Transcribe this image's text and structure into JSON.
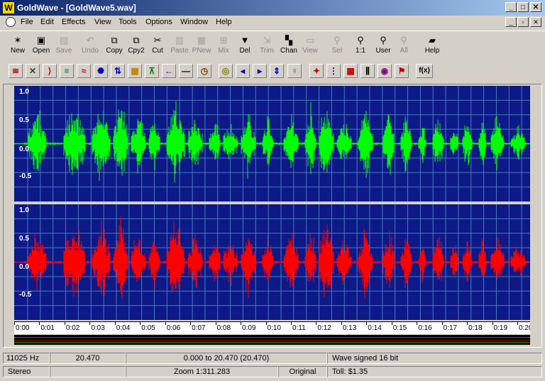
{
  "window": {
    "title": "GoldWave - [GoldWave5.wav]",
    "app_icon": "W"
  },
  "menu": [
    "File",
    "Edit",
    "Effects",
    "View",
    "Tools",
    "Options",
    "Window",
    "Help"
  ],
  "toolbar": [
    {
      "label": "New",
      "icon": "new-icon",
      "glyph": "✶",
      "enabled": true
    },
    {
      "label": "Open",
      "icon": "open-icon",
      "glyph": "▣",
      "enabled": true
    },
    {
      "label": "Save",
      "icon": "save-icon",
      "glyph": "▤",
      "enabled": false
    },
    {
      "label": "Undo",
      "icon": "undo-icon",
      "glyph": "↶",
      "enabled": false
    },
    {
      "label": "Copy",
      "icon": "copy-icon",
      "glyph": "⧉",
      "enabled": true
    },
    {
      "label": "Cpy2",
      "icon": "copy2-icon",
      "glyph": "⧉",
      "enabled": true
    },
    {
      "label": "Cut",
      "icon": "cut-icon",
      "glyph": "✂",
      "enabled": true
    },
    {
      "label": "Paste",
      "icon": "paste-icon",
      "glyph": "▥",
      "enabled": false
    },
    {
      "label": "PNew",
      "icon": "paste-new-icon",
      "glyph": "▦",
      "enabled": false
    },
    {
      "label": "Mix",
      "icon": "mix-icon",
      "glyph": "⊞",
      "enabled": false
    },
    {
      "label": "Del",
      "icon": "delete-icon",
      "glyph": "▼",
      "enabled": true
    },
    {
      "label": "Trim",
      "icon": "trim-icon",
      "glyph": "⇲",
      "enabled": false
    },
    {
      "label": "Chan",
      "icon": "channel-icon",
      "glyph": "▚",
      "enabled": true
    },
    {
      "label": "View",
      "icon": "view-icon",
      "glyph": "▭",
      "enabled": false
    },
    {
      "label": "Sel",
      "icon": "select-icon",
      "glyph": "⚲",
      "enabled": false
    },
    {
      "label": "1:1",
      "icon": "zoom-1-1-icon",
      "glyph": "⚲",
      "enabled": true
    },
    {
      "label": "User",
      "icon": "zoom-user-icon",
      "glyph": "⚲",
      "enabled": true
    },
    {
      "label": "All",
      "icon": "zoom-all-icon",
      "glyph": "⚲",
      "enabled": false
    },
    {
      "label": "Help",
      "icon": "help-book-icon",
      "glyph": "▰",
      "enabled": true
    }
  ],
  "effects_toolbar": [
    {
      "icon": "doppler-icon",
      "glyph": "≋"
    },
    {
      "icon": "dynamics-icon",
      "glyph": "✕"
    },
    {
      "icon": "echo-icon",
      "glyph": "⟩"
    },
    {
      "icon": "equalizer-icon",
      "glyph": "≡"
    },
    {
      "icon": "flange-icon",
      "glyph": "≈"
    },
    {
      "icon": "settings-gear-icon",
      "glyph": "✺"
    },
    {
      "icon": "invert-icon",
      "glyph": "⇅"
    },
    {
      "icon": "mechanize-icon",
      "glyph": "▦"
    },
    {
      "icon": "offset-icon",
      "glyph": "⊼"
    },
    {
      "icon": "left-arrow-icon",
      "glyph": "←"
    },
    {
      "icon": "silence-icon",
      "glyph": "—"
    },
    {
      "icon": "time-warp-icon",
      "glyph": "◷"
    },
    {
      "icon": "fade-in-icon",
      "glyph": "◎"
    },
    {
      "icon": "fade-out-icon",
      "glyph": "◂"
    },
    {
      "icon": "pan-icon",
      "glyph": "▸"
    },
    {
      "icon": "pitch-icon",
      "glyph": "⇕"
    },
    {
      "icon": "volume-icon",
      "glyph": "♀"
    },
    {
      "icon": "noise-reduction-icon",
      "glyph": "✦"
    },
    {
      "icon": "resample-icon",
      "glyph": "⋮"
    },
    {
      "icon": "spectrum-icon",
      "glyph": "▩"
    },
    {
      "icon": "filter-bars-icon",
      "glyph": "⫼"
    },
    {
      "icon": "cd-icon",
      "glyph": "◉"
    },
    {
      "icon": "marker-flag-icon",
      "glyph": "⚑"
    },
    {
      "icon": "expression-evaluator-icon",
      "glyph": "f(x)"
    }
  ],
  "channels": [
    {
      "name": "left",
      "color": "#00ff00",
      "labels": [
        "1.0",
        "0.5",
        "0.0",
        "-0.5"
      ]
    },
    {
      "name": "right",
      "color": "#ff0000",
      "labels": [
        "1.0",
        "0.5",
        "0.0",
        "-0.5"
      ]
    }
  ],
  "timeline": [
    "0:00",
    "0:01",
    "0:02",
    "0:03",
    "0:04",
    "0:05",
    "0:06",
    "0:07",
    "0:08",
    "0:09",
    "0:10",
    "0:11",
    "0:12",
    "0:13",
    "0:14",
    "0:15",
    "0:16",
    "0:17",
    "0:18",
    "0:19",
    "0:20"
  ],
  "waveform_colors": {
    "background": "#0d1987",
    "grid": "#4a7ac0",
    "left": "#00ff00",
    "right": "#ff0000"
  },
  "status": {
    "row1": [
      "11025 Hz",
      "20.470",
      "0.000 to 20.470  (20.470)",
      "Wave signed 16 bit"
    ],
    "row2": [
      "Stereo",
      "",
      "Zoom 1:311.283",
      "Original",
      "Toll: $1.35"
    ]
  }
}
